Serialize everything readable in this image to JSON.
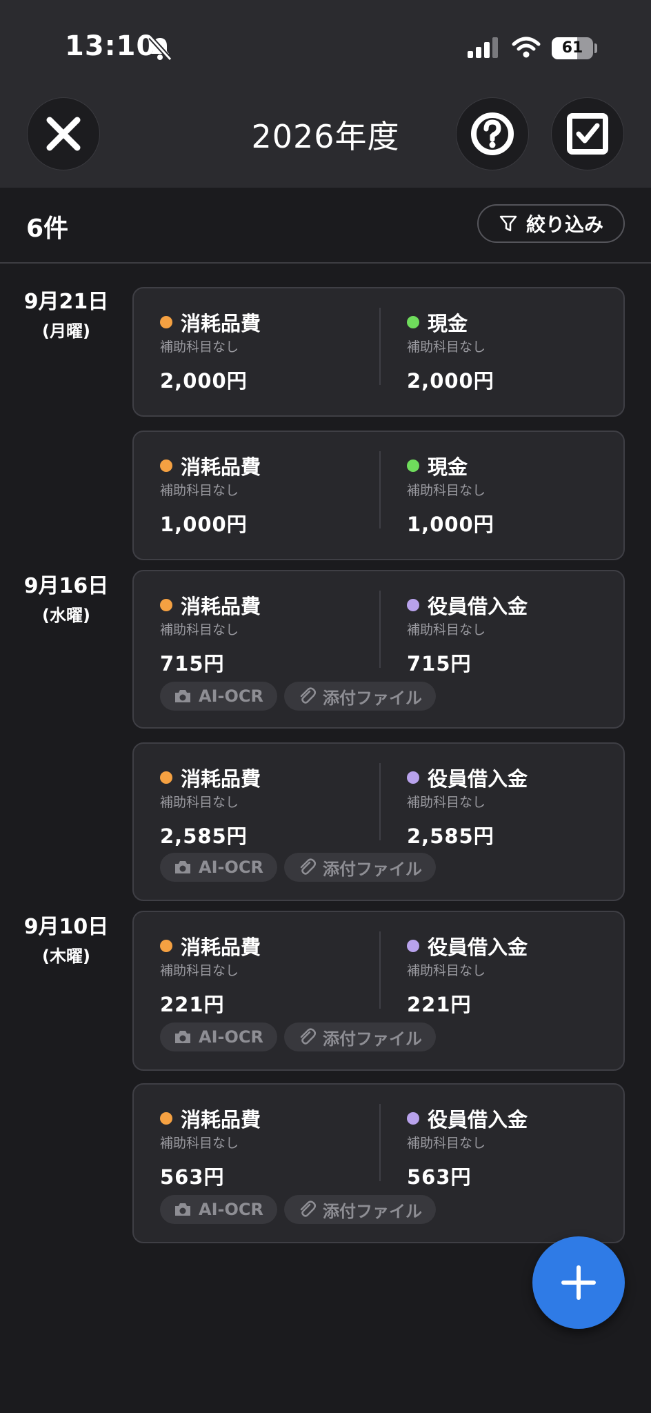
{
  "status": {
    "time": "13:10",
    "battery_level": "61"
  },
  "header": {
    "title": "2026年度"
  },
  "list": {
    "count_label": "6件",
    "filter_label": "絞り込み"
  },
  "dates": [
    {
      "day": "9月21日",
      "weekday": "(月曜)"
    },
    {
      "day": "9月16日",
      "weekday": "(水曜)"
    },
    {
      "day": "9月10日",
      "weekday": "(木曜)"
    }
  ],
  "entries": [
    {
      "debit": {
        "account": "消耗品費",
        "sub": "補助科目なし",
        "amount": "2,000円"
      },
      "credit": {
        "account": "現金",
        "sub": "補助科目なし",
        "amount": "2,000円"
      }
    },
    {
      "debit": {
        "account": "消耗品費",
        "sub": "補助科目なし",
        "amount": "1,000円"
      },
      "credit": {
        "account": "現金",
        "sub": "補助科目なし",
        "amount": "1,000円"
      }
    },
    {
      "debit": {
        "account": "消耗品費",
        "sub": "補助科目なし",
        "amount": "715円"
      },
      "credit": {
        "account": "役員借入金",
        "sub": "補助科目なし",
        "amount": "715円"
      },
      "tags": [
        "AI-OCR",
        "添付ファイル"
      ]
    },
    {
      "debit": {
        "account": "消耗品費",
        "sub": "補助科目なし",
        "amount": "2,585円"
      },
      "credit": {
        "account": "役員借入金",
        "sub": "補助科目なし",
        "amount": "2,585円"
      },
      "tags": [
        "AI-OCR",
        "添付ファイル"
      ]
    },
    {
      "debit": {
        "account": "消耗品費",
        "sub": "補助科目なし",
        "amount": "221円"
      },
      "credit": {
        "account": "役員借入金",
        "sub": "補助科目なし",
        "amount": "221円"
      },
      "tags": [
        "AI-OCR",
        "添付ファイル"
      ]
    },
    {
      "debit": {
        "account": "消耗品費",
        "sub": "補助科目なし",
        "amount": "563円"
      },
      "credit": {
        "account": "役員借入金",
        "sub": "補助科目なし",
        "amount": "563円"
      },
      "tags": [
        "AI-OCR",
        "添付ファイル"
      ]
    }
  ],
  "colors": {
    "expense_dot": "#f5a142",
    "cash_dot": "#6fdc5c",
    "loan_dot": "#b8a2ec",
    "fab": "#2f7be6"
  },
  "icons": {
    "close": "close-icon",
    "help": "help-icon",
    "select": "checkbox-icon",
    "filter": "filter-icon",
    "camera": "camera-icon",
    "attachment": "paperclip-icon",
    "add": "plus-icon"
  }
}
